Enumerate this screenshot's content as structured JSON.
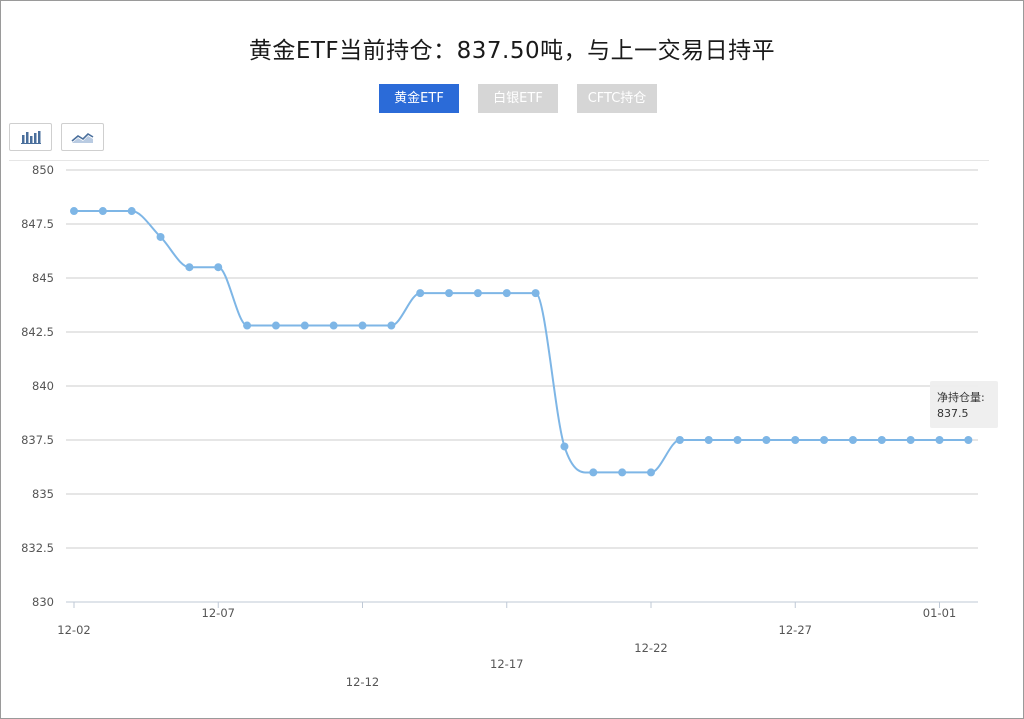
{
  "title": "黄金ETF当前持仓：837.50吨，与上一交易日持平",
  "tabs": [
    {
      "label": "黄金ETF",
      "active": true
    },
    {
      "label": "白银ETF",
      "active": false
    },
    {
      "label": "CFTC持仓",
      "active": false
    }
  ],
  "toolbar": {
    "bar_icon": "bar-chart-icon",
    "line_icon": "line-chart-icon"
  },
  "tooltip": {
    "label": "净持仓量:",
    "value": "837.5"
  },
  "colors": {
    "line": "#7eb6e6",
    "point": "#7eb6e6",
    "active_tab": "#2b6bd8",
    "inactive_tab": "#d6d6d6"
  },
  "chart_data": {
    "type": "line",
    "title": "",
    "xlabel": "",
    "ylabel": "",
    "ylim": [
      830,
      850
    ],
    "yticks": [
      "850",
      "847.5",
      "845",
      "842.5",
      "840",
      "837.5",
      "835",
      "832.5",
      "830"
    ],
    "xtick_labels": [
      "12-02",
      "12-07",
      "12-12",
      "12-17",
      "12-22",
      "12-27",
      "01-01"
    ],
    "grid": true,
    "smooth": true,
    "series": [
      {
        "values": [
          848.1,
          848.1,
          848.1,
          846.9,
          845.5,
          845.5,
          842.8,
          842.8,
          842.8,
          842.8,
          842.8,
          842.8,
          844.3,
          844.3,
          844.3,
          844.3,
          844.3,
          837.2,
          836.0,
          836.0,
          836.0,
          837.5,
          837.5,
          837.5,
          837.5,
          837.5,
          837.5,
          837.5,
          837.5,
          837.5,
          837.5,
          837.5
        ]
      }
    ]
  }
}
